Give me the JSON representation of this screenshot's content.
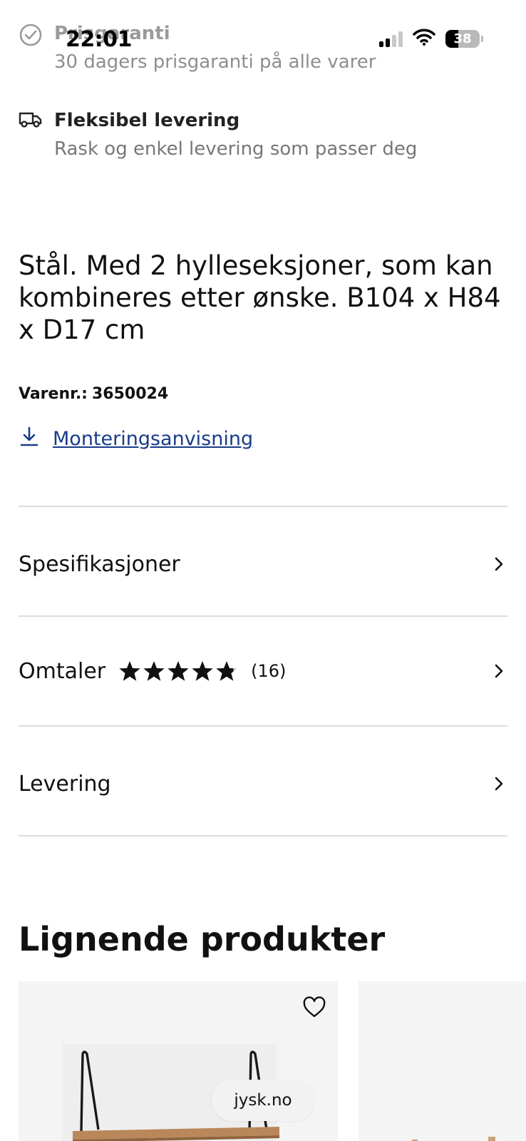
{
  "status_bar": {
    "time": "22:01",
    "battery": "38"
  },
  "features": [
    {
      "title": "Prisgaranti",
      "desc": "30 dagers prisgaranti på alle varer",
      "icon": "check-circle-icon"
    },
    {
      "title": "Fleksibel levering",
      "desc": "Rask og enkel levering som passer deg",
      "icon": "truck-icon"
    }
  ],
  "product": {
    "description": "Stål. Med 2 hylleseksjoner, som kan kombineres etter ønske. B104 x H84 x D17 cm",
    "sku_label": "Varenr.:",
    "sku": "3650024",
    "manual_link": "Monteringsanvisning"
  },
  "accordion": {
    "specs": "Spesifikasjoner",
    "reviews": "Omtaler",
    "review_count": "(16)",
    "rating": 4.5,
    "rating_max": 5,
    "delivery": "Levering"
  },
  "similar": {
    "title": "Lignende produkter"
  },
  "browser": {
    "url": "jysk.no"
  },
  "colors": {
    "link": "#1a3b8a",
    "divider": "#dcdcdc",
    "muted": "#777777"
  }
}
